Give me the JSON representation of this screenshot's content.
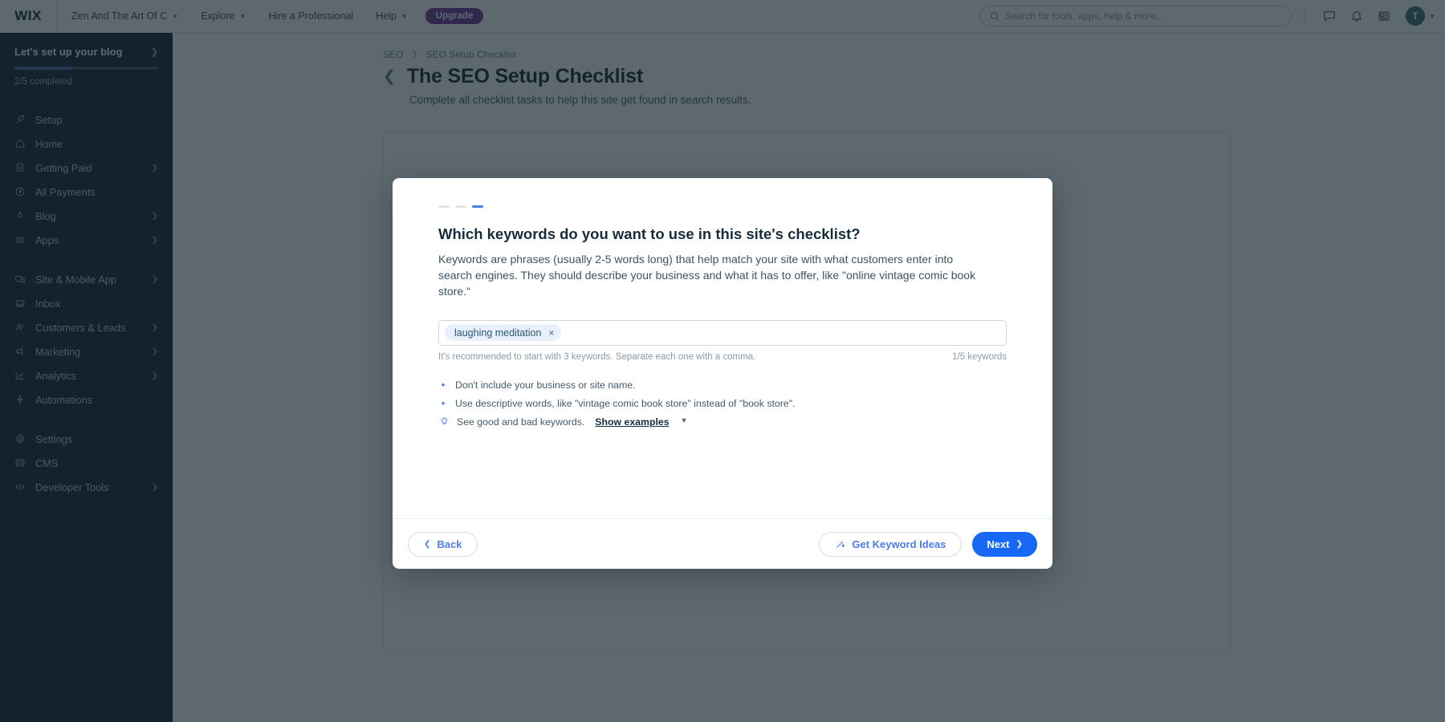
{
  "topbar": {
    "logo": "WIX",
    "site_name": "Zen And The Art Of C",
    "nav": [
      {
        "label": "Explore",
        "has_caret": true
      },
      {
        "label": "Hire a Professional",
        "has_caret": false
      },
      {
        "label": "Help",
        "has_caret": true
      }
    ],
    "upgrade_label": "Upgrade",
    "search_placeholder": "Search for tools, apps, help & more...",
    "icons": [
      "chat-icon",
      "bell-icon",
      "card-icon"
    ],
    "avatar_initial": "T"
  },
  "sidebar": {
    "setup": {
      "title": "Let's set up your blog",
      "progress_text": "2/5 completed",
      "progress_percent": 40
    },
    "groups": [
      {
        "items": [
          {
            "label": "Setup",
            "icon": "rocket-icon",
            "expandable": false
          },
          {
            "label": "Home",
            "icon": "home-icon",
            "expandable": false
          },
          {
            "label": "Getting Paid",
            "icon": "invoice-icon",
            "expandable": true
          },
          {
            "label": "All Payments",
            "icon": "coin-icon",
            "expandable": false
          },
          {
            "label": "Blog",
            "icon": "pen-icon",
            "expandable": true
          },
          {
            "label": "Apps",
            "icon": "apps-icon",
            "expandable": true
          }
        ]
      },
      {
        "items": [
          {
            "label": "Site & Mobile App",
            "icon": "device-icon",
            "expandable": true
          },
          {
            "label": "Inbox",
            "icon": "inbox-icon",
            "expandable": false
          },
          {
            "label": "Customers & Leads",
            "icon": "people-icon",
            "expandable": true
          },
          {
            "label": "Marketing",
            "icon": "megaphone-icon",
            "expandable": true
          },
          {
            "label": "Analytics",
            "icon": "chart-icon",
            "expandable": true
          },
          {
            "label": "Automations",
            "icon": "bolt-icon",
            "expandable": false
          }
        ]
      },
      {
        "items": [
          {
            "label": "Settings",
            "icon": "gear-icon",
            "expandable": false
          },
          {
            "label": "CMS",
            "icon": "database-icon",
            "expandable": false
          },
          {
            "label": "Developer Tools",
            "icon": "code-icon",
            "expandable": true
          }
        ]
      }
    ]
  },
  "page": {
    "breadcrumb": [
      "SEO",
      "SEO Setup Checklist"
    ],
    "title": "The SEO Setup Checklist",
    "subtitle": "Complete all checklist tasks to help this site get found in search results."
  },
  "modal": {
    "steps": {
      "total": 3,
      "active_index": 2
    },
    "title": "Which keywords do you want to use in this site's checklist?",
    "description": "Keywords are phrases (usually 2-5 words long) that help match your site with what customers enter into search engines. They should describe your business and what it has to offer, like \"online vintage comic book store.\"",
    "keywords": [
      {
        "label": "laughing meditation",
        "remove": "×"
      }
    ],
    "helper_text": "It's recommended to start with 3 keywords. Separate each one with a comma.",
    "counter": "1/5 keywords",
    "tips": [
      {
        "type": "bullet",
        "text": "Don't include your business or site name."
      },
      {
        "type": "bullet",
        "text": "Use descriptive words, like \"vintage comic book store\" instead of \"book store\"."
      },
      {
        "type": "hint",
        "text": "See good and bad keywords.",
        "link": "Show examples"
      }
    ],
    "footer": {
      "back_label": "Back",
      "ideas_label": "Get Keyword Ideas",
      "next_label": "Next"
    }
  },
  "colors": {
    "accent_blue": "#1668f5",
    "link_blue": "#4a7de8",
    "sidebar_bg": "#16273c",
    "upgrade_purple": "#9a27d5",
    "avatar_teal": "#18836b"
  }
}
